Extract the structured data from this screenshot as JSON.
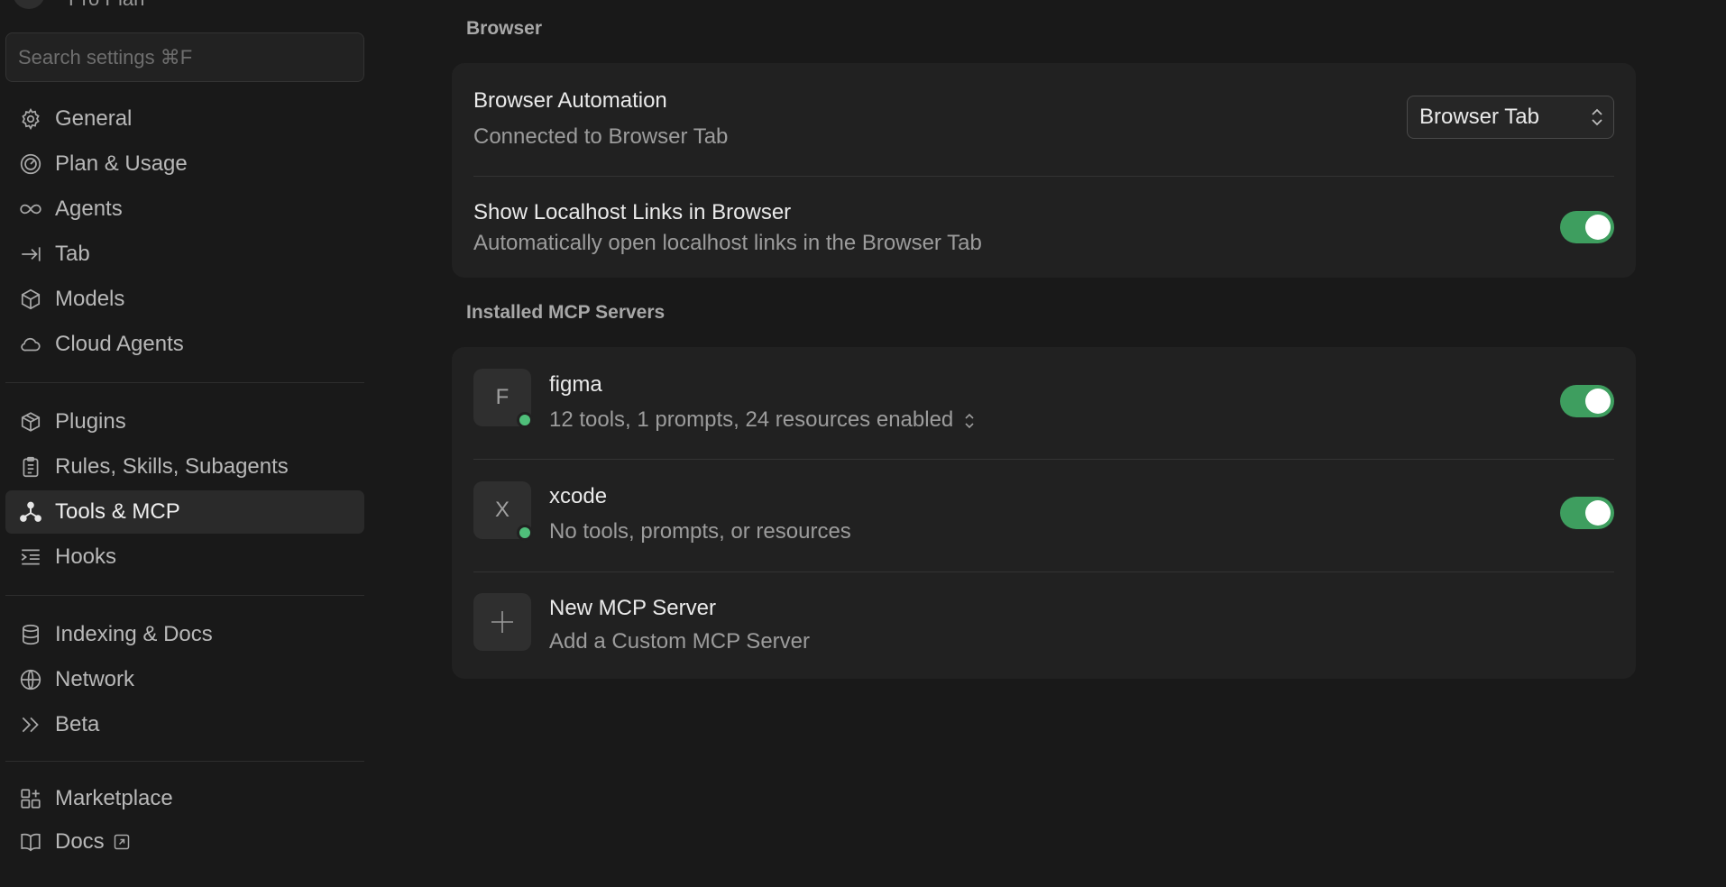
{
  "sidebar": {
    "plan_label": "Pro Plan",
    "search_placeholder": "Search settings ⌘F",
    "groups": [
      [
        {
          "label": "General",
          "icon": "gear-icon"
        },
        {
          "label": "Plan & Usage",
          "icon": "gauge-icon"
        },
        {
          "label": "Agents",
          "icon": "infinity-icon"
        },
        {
          "label": "Tab",
          "icon": "tab-arrow-icon"
        },
        {
          "label": "Models",
          "icon": "cube-icon"
        },
        {
          "label": "Cloud Agents",
          "icon": "cloud-icon"
        }
      ],
      [
        {
          "label": "Plugins",
          "icon": "box-icon"
        },
        {
          "label": "Rules, Skills, Subagents",
          "icon": "clipboard-icon"
        },
        {
          "label": "Tools & MCP",
          "icon": "nodes-icon",
          "active": true
        },
        {
          "label": "Hooks",
          "icon": "list-indent-icon"
        }
      ],
      [
        {
          "label": "Indexing & Docs",
          "icon": "database-icon"
        },
        {
          "label": "Network",
          "icon": "globe-icon"
        },
        {
          "label": "Beta",
          "icon": "chevrons-right-icon"
        }
      ],
      [
        {
          "label": "Marketplace",
          "icon": "grid-plus-icon"
        },
        {
          "label": "Docs",
          "icon": "book-icon",
          "external": true
        }
      ]
    ]
  },
  "browser": {
    "section_title": "Browser",
    "automation": {
      "title": "Browser Automation",
      "subtitle": "Connected to Browser Tab",
      "select_value": "Browser Tab"
    },
    "localhost": {
      "title": "Show Localhost Links in Browser",
      "subtitle": "Automatically open localhost links in the Browser Tab",
      "enabled": true
    }
  },
  "mcp": {
    "section_title": "Installed MCP Servers",
    "servers": [
      {
        "letter": "F",
        "name": "figma",
        "summary": "12 tools, 1 prompts, 24 resources enabled",
        "enabled": true,
        "status_color": "#4fbf7a"
      },
      {
        "letter": "X",
        "name": "xcode",
        "summary": "No tools, prompts, or resources",
        "enabled": true,
        "status_color": "#4fbf7a"
      }
    ],
    "new_server": {
      "title": "New MCP Server",
      "subtitle": "Add a Custom MCP Server"
    }
  },
  "colors": {
    "toggle_on": "#3e9e5f",
    "background": "#191919",
    "card": "#212121"
  }
}
